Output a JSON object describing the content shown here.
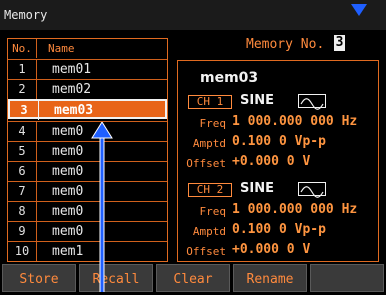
{
  "title": "Memory",
  "memory_no": {
    "label": "Memory No.",
    "value": "3"
  },
  "list": {
    "header": {
      "no": "No.",
      "name": "Name"
    },
    "rows": [
      {
        "no": "1",
        "name": "mem01"
      },
      {
        "no": "2",
        "name": "mem02"
      },
      {
        "no": "3",
        "name": "mem03"
      },
      {
        "no": "4",
        "name": "mem0"
      },
      {
        "no": "5",
        "name": "mem0"
      },
      {
        "no": "6",
        "name": "mem0"
      },
      {
        "no": "7",
        "name": "mem0"
      },
      {
        "no": "8",
        "name": "mem0"
      },
      {
        "no": "9",
        "name": "mem0"
      },
      {
        "no": "10",
        "name": "mem1"
      }
    ],
    "selected_index": 2
  },
  "detail": {
    "name": "mem03",
    "channels": [
      {
        "label": "CH 1",
        "waveform": "SINE",
        "waveform_icon": "sine-wave-icon",
        "freq_label": "Freq",
        "freq_value": "1 000.000 000 Hz",
        "amptd_label": "Amptd",
        "amptd_value": "0.100 0 Vp-p",
        "offset_label": "Offset",
        "offset_value": "+0.000 0 V"
      },
      {
        "label": "CH 2",
        "waveform": "SINE",
        "waveform_icon": "sine-wave-icon",
        "freq_label": "Freq",
        "freq_value": "1 000.000 000 Hz",
        "amptd_label": "Amptd",
        "amptd_value": "0.100 0 Vp-p",
        "offset_label": "Offset",
        "offset_value": "+0.000 0 V"
      }
    ]
  },
  "softkeys": [
    "Store",
    "Recall",
    "Clear",
    "Rename",
    ""
  ],
  "colors": {
    "accent": "#ff8a3d",
    "selected": "#e86418",
    "arrow": "#1f5fff"
  },
  "annotations": [
    "up-arrow-icon",
    "down-arrow-icon"
  ]
}
